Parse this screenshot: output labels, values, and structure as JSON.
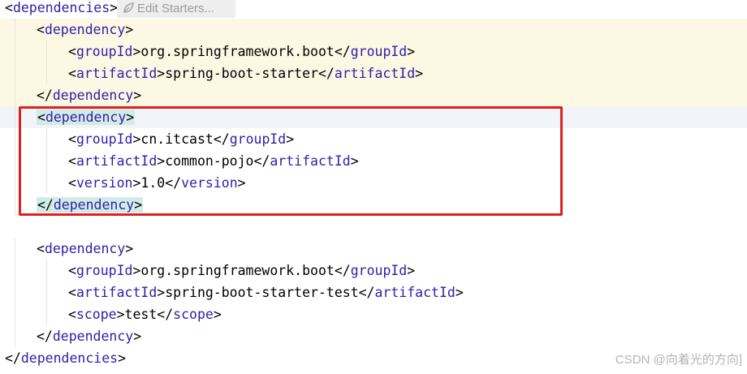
{
  "codelens": {
    "label": "Edit Starters..."
  },
  "lines": [
    {
      "indent": 0,
      "parts": [
        [
          "p",
          "<"
        ],
        [
          "t",
          "dependencies"
        ],
        [
          "p",
          ">"
        ]
      ]
    },
    {
      "indent": 1,
      "hl": true,
      "parts": [
        [
          "p",
          "<"
        ],
        [
          "t",
          "dependency"
        ],
        [
          "p",
          ">"
        ]
      ]
    },
    {
      "indent": 2,
      "hl": true,
      "parts": [
        [
          "p",
          "<"
        ],
        [
          "t",
          "groupId"
        ],
        [
          "p",
          ">org.springframework.boot</"
        ],
        [
          "t",
          "groupId"
        ],
        [
          "p",
          ">"
        ]
      ]
    },
    {
      "indent": 2,
      "hl": true,
      "parts": [
        [
          "p",
          "<"
        ],
        [
          "t",
          "artifactId"
        ],
        [
          "p",
          ">spring-boot-starter</"
        ],
        [
          "t",
          "artifactId"
        ],
        [
          "p",
          ">"
        ]
      ]
    },
    {
      "indent": 1,
      "hl": true,
      "parts": [
        [
          "p",
          "</"
        ],
        [
          "t",
          "dependency"
        ],
        [
          "p",
          ">"
        ]
      ]
    },
    {
      "indent": 1,
      "sel": true,
      "match": true,
      "parts": [
        [
          "p",
          "<"
        ],
        [
          "t",
          "dependency"
        ],
        [
          "p",
          ">"
        ]
      ]
    },
    {
      "indent": 2,
      "parts": [
        [
          "p",
          "<"
        ],
        [
          "t",
          "groupId"
        ],
        [
          "p",
          ">cn.itcast</"
        ],
        [
          "t",
          "groupId"
        ],
        [
          "p",
          ">"
        ]
      ]
    },
    {
      "indent": 2,
      "parts": [
        [
          "p",
          "<"
        ],
        [
          "t",
          "artifactId"
        ],
        [
          "p",
          ">common-pojo</"
        ],
        [
          "t",
          "artifactId"
        ],
        [
          "p",
          ">"
        ]
      ]
    },
    {
      "indent": 2,
      "parts": [
        [
          "p",
          "<"
        ],
        [
          "t",
          "version"
        ],
        [
          "p",
          ">1.0</"
        ],
        [
          "t",
          "version"
        ],
        [
          "p",
          ">"
        ]
      ]
    },
    {
      "indent": 1,
      "match": true,
      "parts": [
        [
          "p",
          "</"
        ],
        [
          "t",
          "dependency"
        ],
        [
          "p",
          ">"
        ]
      ]
    },
    {
      "indent": 0,
      "parts": []
    },
    {
      "indent": 1,
      "parts": [
        [
          "p",
          "<"
        ],
        [
          "t",
          "dependency"
        ],
        [
          "p",
          ">"
        ]
      ]
    },
    {
      "indent": 2,
      "parts": [
        [
          "p",
          "<"
        ],
        [
          "t",
          "groupId"
        ],
        [
          "p",
          ">org.springframework.boot</"
        ],
        [
          "t",
          "groupId"
        ],
        [
          "p",
          ">"
        ]
      ]
    },
    {
      "indent": 2,
      "parts": [
        [
          "p",
          "<"
        ],
        [
          "t",
          "artifactId"
        ],
        [
          "p",
          ">spring-boot-starter-test</"
        ],
        [
          "t",
          "artifactId"
        ],
        [
          "p",
          ">"
        ]
      ]
    },
    {
      "indent": 2,
      "parts": [
        [
          "p",
          "<"
        ],
        [
          "t",
          "scope"
        ],
        [
          "p",
          ">test</"
        ],
        [
          "t",
          "scope"
        ],
        [
          "p",
          ">"
        ]
      ]
    },
    {
      "indent": 1,
      "parts": [
        [
          "p",
          "</"
        ],
        [
          "t",
          "dependency"
        ],
        [
          "p",
          ">"
        ]
      ]
    },
    {
      "indent": 0,
      "parts": [
        [
          "p",
          "</"
        ],
        [
          "t",
          "dependencies"
        ],
        [
          "p",
          ">"
        ]
      ]
    }
  ],
  "watermark": "CSDN @向着光的方向]"
}
